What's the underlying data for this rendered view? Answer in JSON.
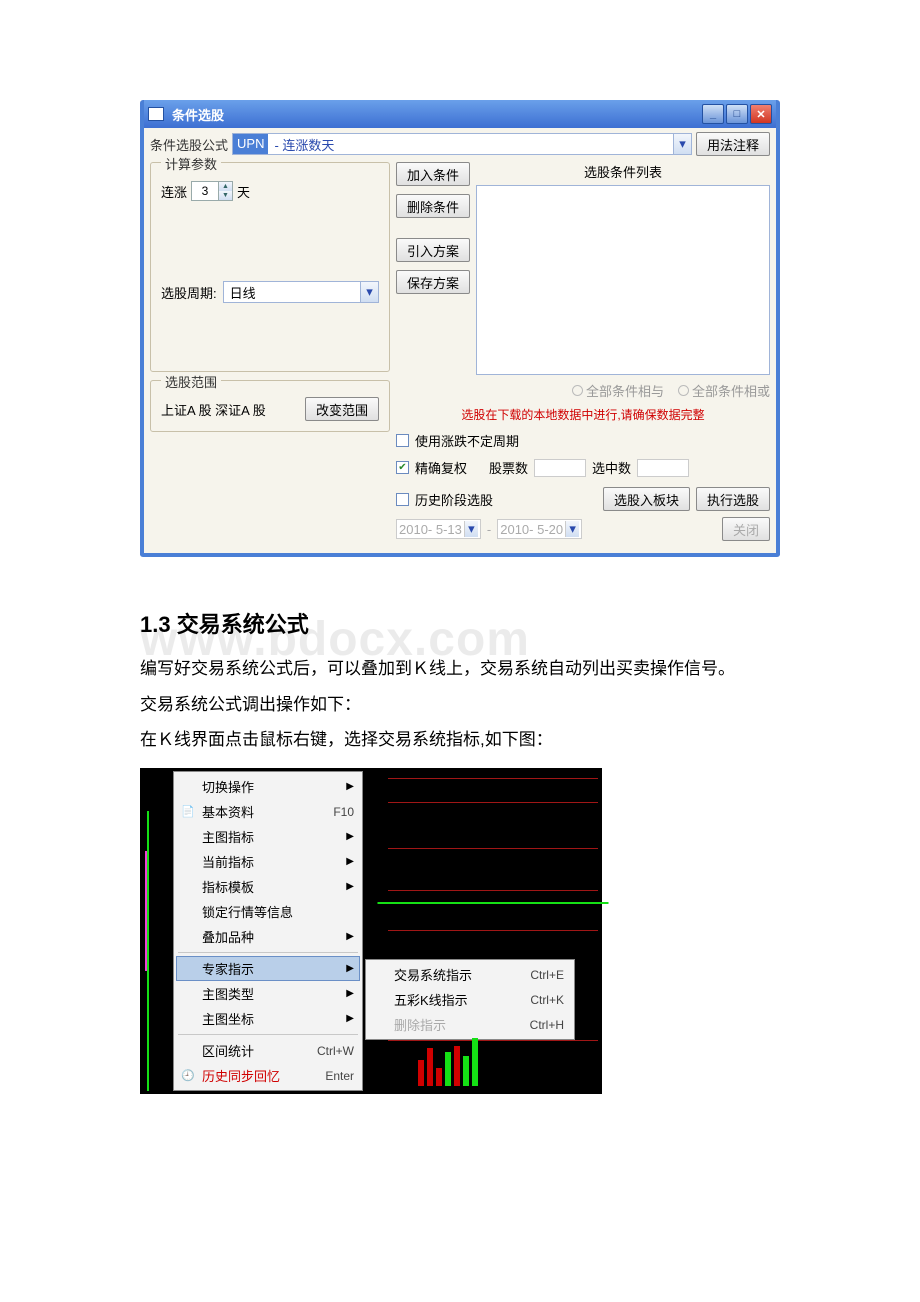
{
  "watermark": "www.bdocx.com",
  "dialog": {
    "title": "条件选股",
    "formula_label": "条件选股公式",
    "formula_code": "UPN",
    "formula_desc": "- 连涨数天",
    "usage_btn": "用法注释",
    "calc_params_legend": "计算参数",
    "param_label_prefix": "连涨",
    "param_value": "3",
    "param_label_suffix": "天",
    "period_label": "选股周期:",
    "period_value": "日线",
    "scope_legend": "选股范围",
    "scope_text": "上证A 股  深证A 股",
    "scope_btn": "改变范围",
    "list_title": "选股条件列表",
    "btn_add": "加入条件",
    "btn_del": "删除条件",
    "btn_import": "引入方案",
    "btn_save": "保存方案",
    "radio_and": "全部条件相与",
    "radio_or": "全部条件相或",
    "warning": "选股在下载的本地数据中进行,请确保数据完整",
    "chk_varperiod": "使用涨跌不定周期",
    "chk_fuquan": "精确复权",
    "stocks_label": "股票数",
    "selected_label": "选中数",
    "chk_history": "历史阶段选股",
    "btn_to_block": "选股入板块",
    "btn_run": "执行选股",
    "btn_close": "关闭",
    "date_from": "2010- 5-13",
    "date_to": "2010- 5-20",
    "date_sep": "-"
  },
  "article": {
    "heading": "1.3 交易系统公式",
    "p1": "编写好交易系统公式后，可以叠加到Ｋ线上，交易系统自动列出买卖操作信号。",
    "p2": "交易系统公式调出操作如下：",
    "p3": "在Ｋ线界面点击鼠标右键，选择交易系统指标,如下图："
  },
  "menu": {
    "items": [
      {
        "label": "切换操作",
        "sub": true
      },
      {
        "label": "基本资料",
        "shortcut": "F10",
        "icon": "doc"
      },
      {
        "label": "主图指标",
        "sub": true
      },
      {
        "label": "当前指标",
        "sub": true
      },
      {
        "label": "指标模板",
        "sub": true
      },
      {
        "label": "锁定行情等信息"
      },
      {
        "label": "叠加品种",
        "sub": true
      },
      {
        "sep": true
      },
      {
        "label": "专家指示",
        "sub": true,
        "hl": true
      },
      {
        "label": "主图类型",
        "sub": true
      },
      {
        "label": "主图坐标",
        "sub": true
      },
      {
        "sep": true
      },
      {
        "label": "区间统计",
        "shortcut": "Ctrl+W"
      },
      {
        "label": "历史同步回忆",
        "shortcut": "Enter",
        "red": true,
        "icon": "clock"
      }
    ],
    "submenu": [
      {
        "label": "交易系统指示",
        "shortcut": "Ctrl+E"
      },
      {
        "label": "五彩K线指示",
        "shortcut": "Ctrl+K"
      },
      {
        "label": "删除指示",
        "shortcut": "Ctrl+H",
        "dim": true
      }
    ]
  }
}
